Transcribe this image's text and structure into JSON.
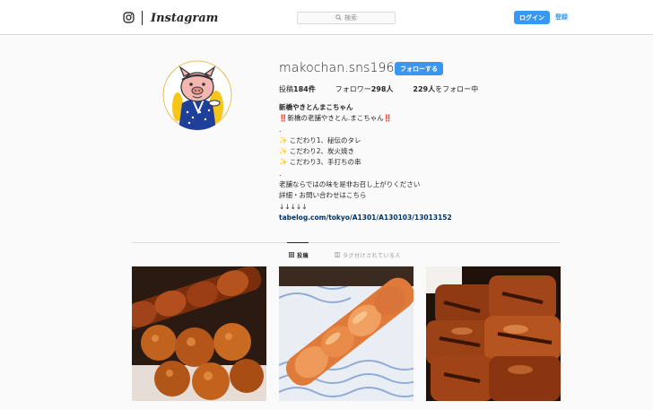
{
  "header": {
    "logo_text": "Instagram",
    "search_placeholder": "検索",
    "login_label": "ログイン",
    "signup_label": "登録"
  },
  "profile": {
    "username": "makochan.sns1968",
    "follow_label": "フォローする",
    "stats": {
      "posts_label": "投稿",
      "posts_value": "184件",
      "followers_label": "フォロワー",
      "followers_value": "298人",
      "following_value": "229人",
      "following_label": "をフォロー中"
    },
    "bio": {
      "name": "新橋やきとんまこちゃん",
      "lines": [
        "‼️新橋の老舗やきとん.まこちゃん‼️",
        ".",
        "こだわり1、秘伝のタレ",
        "こだわり2、炭火焼き",
        "こだわり3、手打ちの串",
        ".",
        "老舗ならではの味を是非お召し上がりください",
        "詳細・お問い合わせはこちら",
        "↓↓↓↓↓"
      ],
      "sparkle": "✨",
      "link": "tabelog.com/tokyo/A1301/A130103/13013152"
    }
  },
  "tabs": {
    "posts_label": "投稿",
    "tagged_label": "タグ付けされている人"
  },
  "posts": [
    {
      "alt": "tsukune skewers"
    },
    {
      "alt": "grilled chicken skewer"
    },
    {
      "alt": "glazed pork skewers"
    }
  ],
  "colors": {
    "accent": "#3897f0",
    "link": "#003569"
  }
}
